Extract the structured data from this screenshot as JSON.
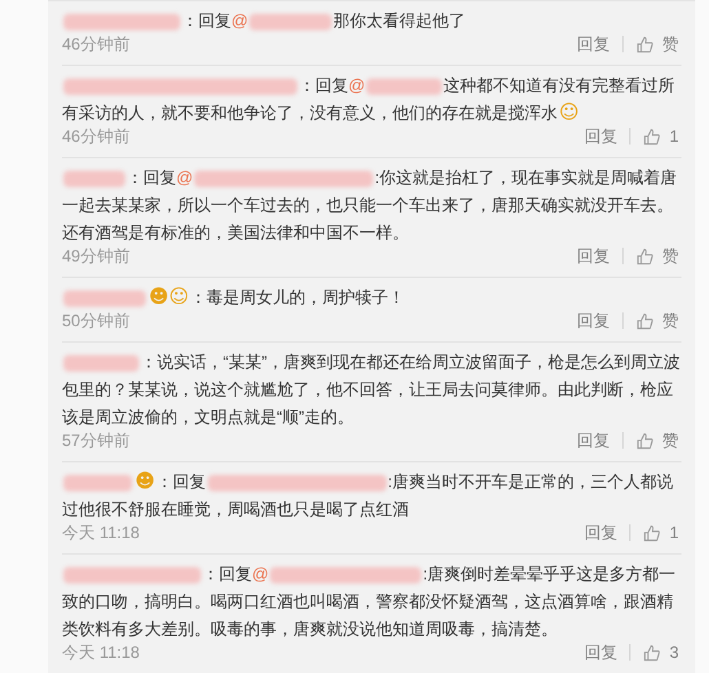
{
  "comments": [
    {
      "separator": "：",
      "reply_label": "回复",
      "mention": "@",
      "text": "那你太看得起他了",
      "time": "46分钟前",
      "reply": "回复",
      "like": "赞"
    },
    {
      "separator": "：",
      "reply_label": "回复",
      "mention": "@",
      "text": "这种都不知道有没有完整看过所有采访的人，就不要和他争论了，没有意义，他们的存在就是搅浑水",
      "trailing_emoji": "☺",
      "time": "46分钟前",
      "reply": "回复",
      "like": "1"
    },
    {
      "separator": "：",
      "reply_label": "回复",
      "mention": "@",
      "text": ":你这就是抬杠了，现在事实就是周喊着唐一起去某某家，所以一个车过去的，也只能一个车出来了，唐那天确实就没开车去。还有酒驾是有标准的，美国法律和中国不一样。",
      "time": "49分钟前",
      "reply": "回复",
      "like": "赞"
    },
    {
      "name_emoji": "☻☺",
      "separator": "：",
      "text": "毒是周女儿的，周护犊子！",
      "time": "50分钟前",
      "reply": "回复",
      "like": "赞"
    },
    {
      "separator": "：",
      "text": "说实话，“某某”，唐爽到现在都还在给周立波留面子，枪是怎么到周立波包里的？某某说，说这个就尴尬了，他不回答，让王局去问莫律师。由此判断，枪应该是周立波偷的，文明点就是“顺”走的。",
      "time": "57分钟前",
      "reply": "回复",
      "like": "赞"
    },
    {
      "name_emoji": "☻",
      "separator": "：",
      "reply_label": "回复",
      "text": ":唐爽当时不开车是正常的，三个人都说过他很不舒服在睡觉，周喝酒也只是喝了点红酒",
      "time": "今天 11:18",
      "reply": "回复",
      "like": "1"
    },
    {
      "separator": "：",
      "reply_label": "回复",
      "mention": "@",
      "text": ":唐爽倒时差晕晕乎乎这是多方都一致的口吻，搞明白。喝两口红酒也叫喝酒，警察都没怀疑酒驾，这点酒算啥，跟酒精类饮料有多大差别。吸毒的事，唐爽就没说他知道周吸毒，搞清楚。",
      "time": "今天 11:18",
      "reply": "回复",
      "like": "3"
    }
  ]
}
